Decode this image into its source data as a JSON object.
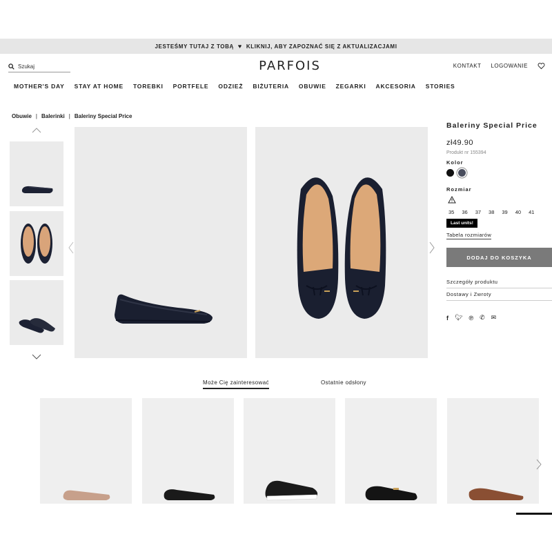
{
  "announcement": {
    "text_left": "JESTEŚMY TUTAJ Z TOBĄ",
    "text_right": "KLIKNIJ, ABY ZAPOZNAĆ SIĘ Z AKTUALIZACJAMI"
  },
  "header": {
    "search_placeholder": "Szukaj",
    "logo": "PARFOIS",
    "contact": "KONTAKT",
    "login": "LOGOWANIE"
  },
  "nav": [
    "MOTHER'S DAY",
    "STAY AT HOME",
    "TOREBKI",
    "PORTFELE",
    "ODZIEŻ",
    "BIŻUTERIA",
    "OBUWIE",
    "ZEGARKI",
    "AKCESORIA",
    "STORIES"
  ],
  "breadcrumb": [
    "Obuwie",
    "Balerinki",
    "Baleriny Special Price"
  ],
  "product": {
    "title": "Baleriny Special Price",
    "price": "zł49.90",
    "code": "Produkt nr 155394",
    "color_label": "Kolor",
    "colors": [
      "#111111",
      "#4a4e5e"
    ],
    "size_label": "Rozmiar",
    "sizes": [
      "35",
      "36",
      "37",
      "38",
      "39",
      "40",
      "41"
    ],
    "last_units": "Last units!",
    "size_table": "Tabela rozmiarów",
    "add_to_cart": "DODAJ DO KOSZYKA",
    "details": "Szczegóły produktu",
    "shipping": "Dostawy i Zwroty"
  },
  "share_icons": [
    "facebook-icon",
    "twitter-icon",
    "pinterest-icon",
    "whatsapp-icon",
    "email-icon"
  ],
  "tabs": {
    "recommended": "Może Cię zainteresować",
    "recent": "Ostatnie odsłony"
  }
}
